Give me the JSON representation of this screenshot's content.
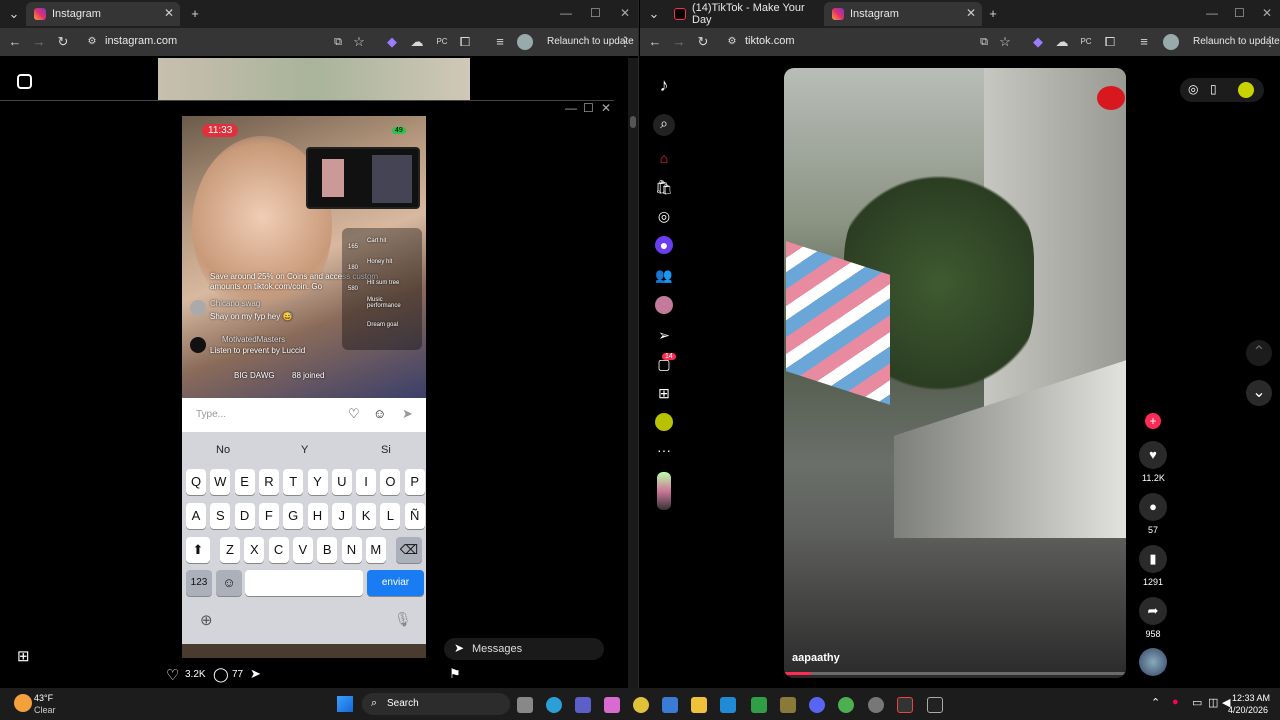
{
  "left_window": {
    "tab_title": "Instagram",
    "url": "instagram.com",
    "relaunch": "Relaunch to update",
    "likes": "3.2K",
    "comments": "77",
    "messages_label": "Messages"
  },
  "phone": {
    "time": "11:33",
    "battery": "49",
    "chat": [
      {
        "user": "",
        "text": "Save around 25% on Coins and access custom amounts on tiktok.com/coin. Go"
      },
      {
        "user": "Chicano swag",
        "text": "Shay on my fyp hey 😅"
      },
      {
        "user": "MotivatedMasters",
        "text": "Listen to prevent by Luccid"
      },
      {
        "user": "BIG DAWG",
        "text": "88 joined"
      }
    ],
    "gifts": [
      "Cart hit",
      "Honey hit",
      "Hit sum tree",
      "Music performance",
      "Dream goal"
    ],
    "gift_counts": [
      "165",
      "180",
      "580"
    ],
    "input_placeholder": "Type...",
    "suggestions": [
      "No",
      "Y",
      "Si"
    ],
    "row1": [
      "Q",
      "W",
      "E",
      "R",
      "T",
      "Y",
      "U",
      "I",
      "O",
      "P"
    ],
    "row2": [
      "A",
      "S",
      "D",
      "F",
      "G",
      "H",
      "J",
      "K",
      "L",
      "Ñ"
    ],
    "row3": [
      "Z",
      "X",
      "C",
      "V",
      "B",
      "N",
      "M"
    ],
    "key_123": "123",
    "key_send": "enviar"
  },
  "right_window": {
    "tab1_title": "(14)TikTok - Make Your Day",
    "tab2_title": "Instagram",
    "url": "tiktok.com",
    "relaunch": "Relaunch to update",
    "username": "aapaathy",
    "likes": "11.2K",
    "comments": "57",
    "saves": "1291",
    "shares": "958",
    "inbox_badge": "14"
  },
  "taskbar": {
    "temp": "43°F",
    "weather": "Clear",
    "search": "Search",
    "time": "12:33 AM",
    "date": "4/20/2026"
  },
  "colors": {
    "accent_red": "#fe2c55",
    "send_blue": "#1a7cf2"
  }
}
